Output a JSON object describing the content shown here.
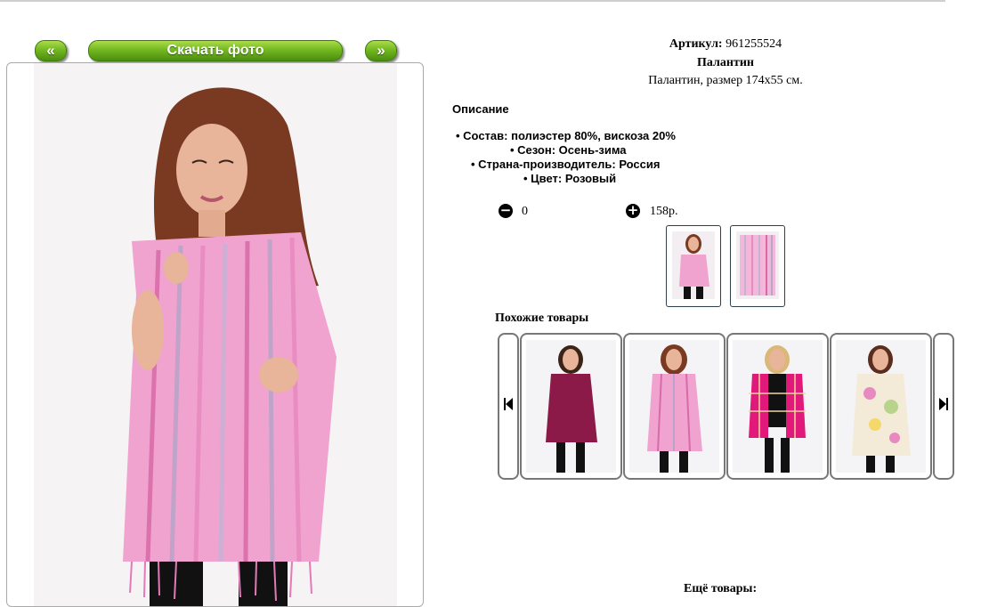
{
  "nav": {
    "prev_label": "«",
    "download_label": "Скачать фото",
    "next_label": "»"
  },
  "product": {
    "article_label": "Артикул:",
    "article_value": "961255524",
    "title": "Палантин",
    "short_desc": "Палантин, размер 174x55 см."
  },
  "description": {
    "heading": "Описание",
    "items": [
      "Состав: полиэстер 80%, вискоза 20%",
      "Сезон: Осень-зима",
      "Страна-производитель: Россия",
      "Цвет: Розовый"
    ]
  },
  "cart": {
    "minus_icon": "minus-circle-icon",
    "quantity": "0",
    "plus_icon": "plus-circle-icon",
    "price": "158р."
  },
  "similar": {
    "heading": "Похожие товары"
  },
  "more": {
    "heading": "Ещё товары:"
  },
  "colors": {
    "button_green": "#74b821",
    "scarf_pink": "#f0a3cf",
    "burgundy": "#8b1a48",
    "fuchsia": "#e0197a"
  }
}
